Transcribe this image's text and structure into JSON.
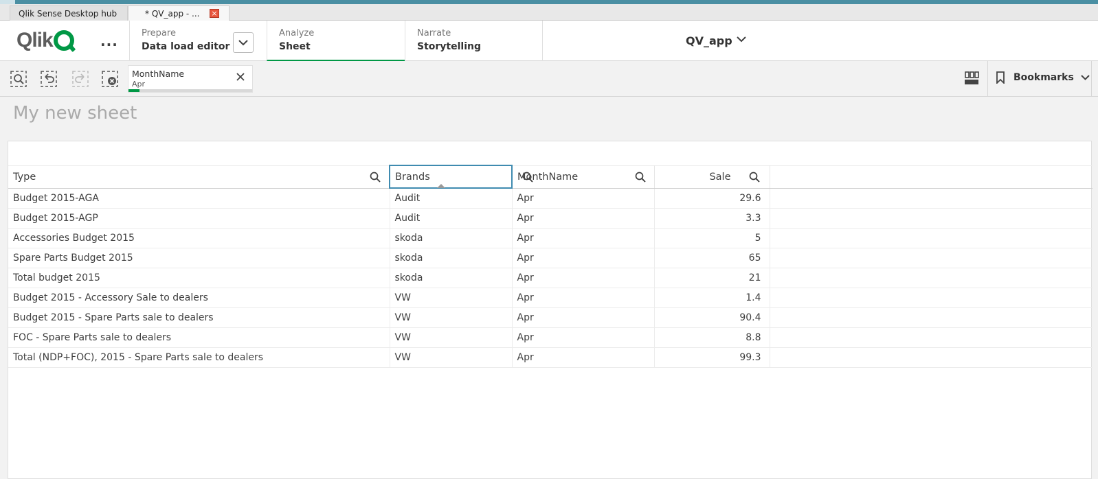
{
  "browser_tabs": [
    {
      "label": "Qlik Sense Desktop hub"
    },
    {
      "label": "* QV_app - ...",
      "close": "×"
    }
  ],
  "header": {
    "logo": "Qlik",
    "more": "...",
    "prepare": {
      "small": "Prepare",
      "big": "Data load editor"
    },
    "analyze": {
      "small": "Analyze",
      "big": "Sheet"
    },
    "narrate": {
      "small": "Narrate",
      "big": "Storytelling"
    },
    "app_name": "QV_app"
  },
  "selection": {
    "field": "MonthName",
    "value": "Apr",
    "progress": 0.09
  },
  "bookmarks_label": "Bookmarks",
  "sheet_title": "My new sheet",
  "table": {
    "columns": [
      "Type",
      "Brands",
      "MonthName",
      "Sale"
    ],
    "rows": [
      [
        "Budget 2015-AGA",
        "Audit",
        "Apr",
        "29.6"
      ],
      [
        "Budget 2015-AGP",
        "Audit",
        "Apr",
        "3.3"
      ],
      [
        "Accessories Budget 2015",
        "skoda",
        "Apr",
        "5"
      ],
      [
        "Spare Parts Budget 2015",
        "skoda",
        "Apr",
        "65"
      ],
      [
        "Total budget 2015",
        "skoda",
        "Apr",
        "21"
      ],
      [
        "Budget 2015 - Accessory Sale to dealers",
        "VW",
        "Apr",
        "1.4"
      ],
      [
        "Budget 2015 - Spare Parts sale to dealers",
        "VW",
        "Apr",
        "90.4"
      ],
      [
        "FOC - Spare Parts sale to dealers",
        "VW",
        "Apr",
        "8.8"
      ],
      [
        "Total (NDP+FOC), 2015 - Spare Parts sale to dealers",
        "VW",
        "Apr",
        "99.3"
      ]
    ]
  },
  "colors": {
    "accent": "#009845",
    "topstrip": "#4a8fa3",
    "focus": "#3f8bb0"
  }
}
